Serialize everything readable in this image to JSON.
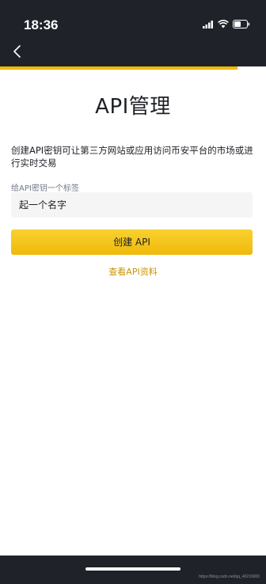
{
  "status_bar": {
    "time": "18:36"
  },
  "page": {
    "title": "API管理",
    "description": "创建API密钥可让第三方网站或应用访问币安平台的市场或进行实时交易",
    "label_field": {
      "label": "给API密钥一个标签",
      "placeholder": "起一个名字"
    },
    "create_button": "创建 API",
    "view_docs_link": "查看API资料"
  },
  "footer": {
    "watermark": "https://blog.csdn.net/qq_40216000"
  },
  "colors": {
    "accent": "#f0b90b",
    "dark_bar": "#1f2329",
    "link": "#c99400"
  }
}
